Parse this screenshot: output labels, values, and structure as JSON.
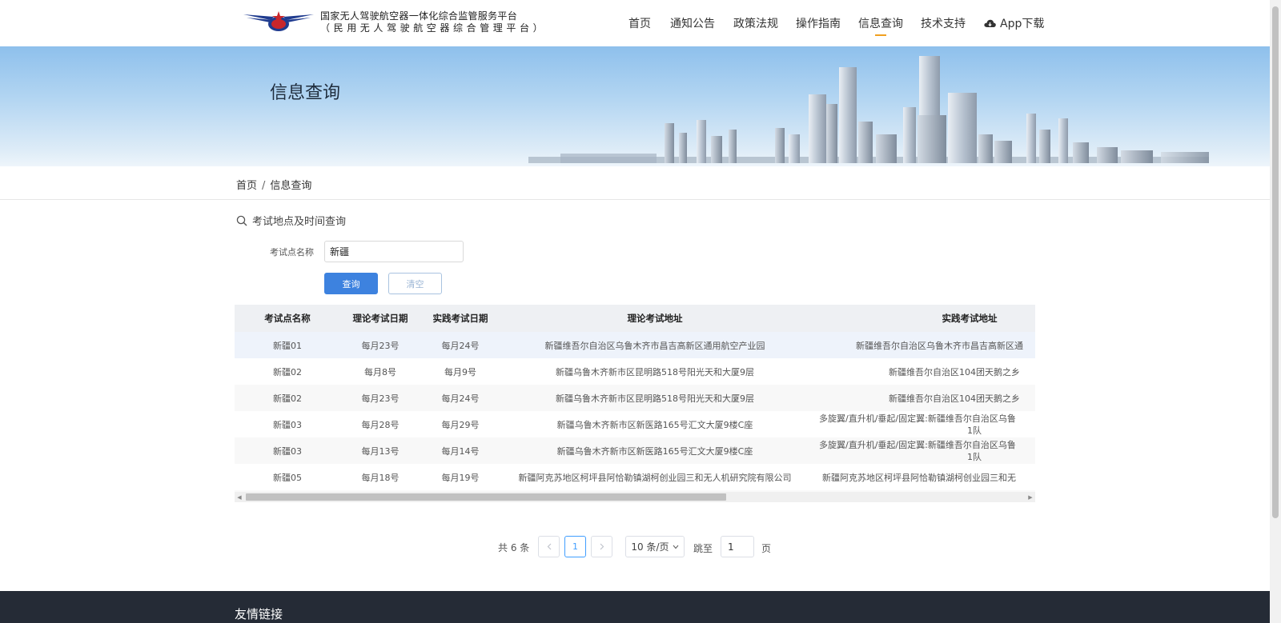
{
  "header": {
    "org_line1": "国家无人驾驶航空器一体化综合监管服务平台",
    "org_line2": "（民用无人驾驶航空器综合管理平台）",
    "logo_icon": "wings-star-emblem-icon",
    "nav": [
      {
        "label": "首页"
      },
      {
        "label": "通知公告"
      },
      {
        "label": "政策法规"
      },
      {
        "label": "操作指南"
      },
      {
        "label": "信息查询",
        "active": true
      },
      {
        "label": "技术支持"
      },
      {
        "label": "App下载",
        "icon": "cloud-download-icon"
      }
    ],
    "accent_color": "#f0a020"
  },
  "banner": {
    "title": "信息查询"
  },
  "breadcrumb": {
    "home": "首页",
    "separator": "/",
    "current": "信息查询"
  },
  "search": {
    "section_title": "考试地点及时间查询",
    "label": "考试点名称",
    "value": "新疆",
    "query_label": "查询",
    "clear_label": "清空",
    "button_color": "#3d82df"
  },
  "table": {
    "headers": [
      "考试点名称",
      "理论考试日期",
      "实践考试日期",
      "理论考试地址",
      "实践考试地址"
    ],
    "rows": [
      {
        "name": "新疆01",
        "theory_date": "每月23号",
        "practice_date": "每月24号",
        "theory_addr": "新疆维吾尔自治区乌鲁木齐市昌吉高新区通用航空产业园",
        "practice_addr": "新疆维吾尔自治区乌鲁木齐市昌吉高新区通"
      },
      {
        "name": "新疆02",
        "theory_date": "每月8号",
        "practice_date": "每月9号",
        "theory_addr": "新疆乌鲁木齐新市区昆明路518号阳光天和大厦9层",
        "practice_addr": "新疆维吾尔自治区104团天鹅之乡"
      },
      {
        "name": "新疆02",
        "theory_date": "每月23号",
        "practice_date": "每月24号",
        "theory_addr": "新疆乌鲁木齐新市区昆明路518号阳光天和大厦9层",
        "practice_addr": "新疆维吾尔自治区104团天鹅之乡"
      },
      {
        "name": "新疆03",
        "theory_date": "每月28号",
        "practice_date": "每月29号",
        "theory_addr": "新疆乌鲁木齐新市区新医路165号汇文大厦9楼C座",
        "practice_addr": "多旋翼/直升机/垂起/固定翼:新疆维吾尔自治区乌鲁",
        "practice_addr_line2": "1队"
      },
      {
        "name": "新疆03",
        "theory_date": "每月13号",
        "practice_date": "每月14号",
        "theory_addr": "新疆乌鲁木齐新市区新医路165号汇文大厦9楼C座",
        "practice_addr": "多旋翼/直升机/垂起/固定翼:新疆维吾尔自治区乌鲁",
        "practice_addr_line2": "1队"
      },
      {
        "name": "新疆05",
        "theory_date": "每月18号",
        "practice_date": "每月19号",
        "theory_addr": "新疆阿克苏地区柯坪县阿恰勒镇湖柯创业园三和无人机研究院有限公司",
        "practice_addr": "新疆阿克苏地区柯坪县阿恰勒镇湖柯创业园三和无"
      }
    ]
  },
  "pagination": {
    "total": "共 6 条",
    "prev_icon": "chevron-left-icon",
    "current_page": "1",
    "next_icon": "chevron-right-icon",
    "page_size": "10 条/页",
    "jump_label": "跳至",
    "jump_value": "1",
    "page_unit": "页",
    "active_color": "#409eff"
  },
  "footer": {
    "title": "友情链接"
  }
}
